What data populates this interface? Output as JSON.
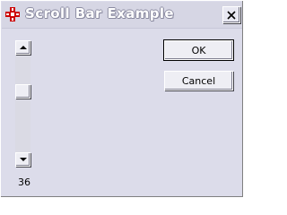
{
  "window": {
    "title": "Scroll Bar Example",
    "icon": "red-cross-app-icon",
    "close_icon": "close-icon"
  },
  "scrollbar": {
    "orientation": "vertical",
    "min": 0,
    "max": 100,
    "value": 36,
    "up_icon": "arrow-up-icon",
    "down_icon": "arrow-down-icon"
  },
  "value_label": "36",
  "buttons": {
    "ok": "OK",
    "cancel": "Cancel"
  },
  "colors": {
    "background": "#dcdcea",
    "title_outline": "#8a8aa0",
    "icon_red": "#cc0000"
  }
}
